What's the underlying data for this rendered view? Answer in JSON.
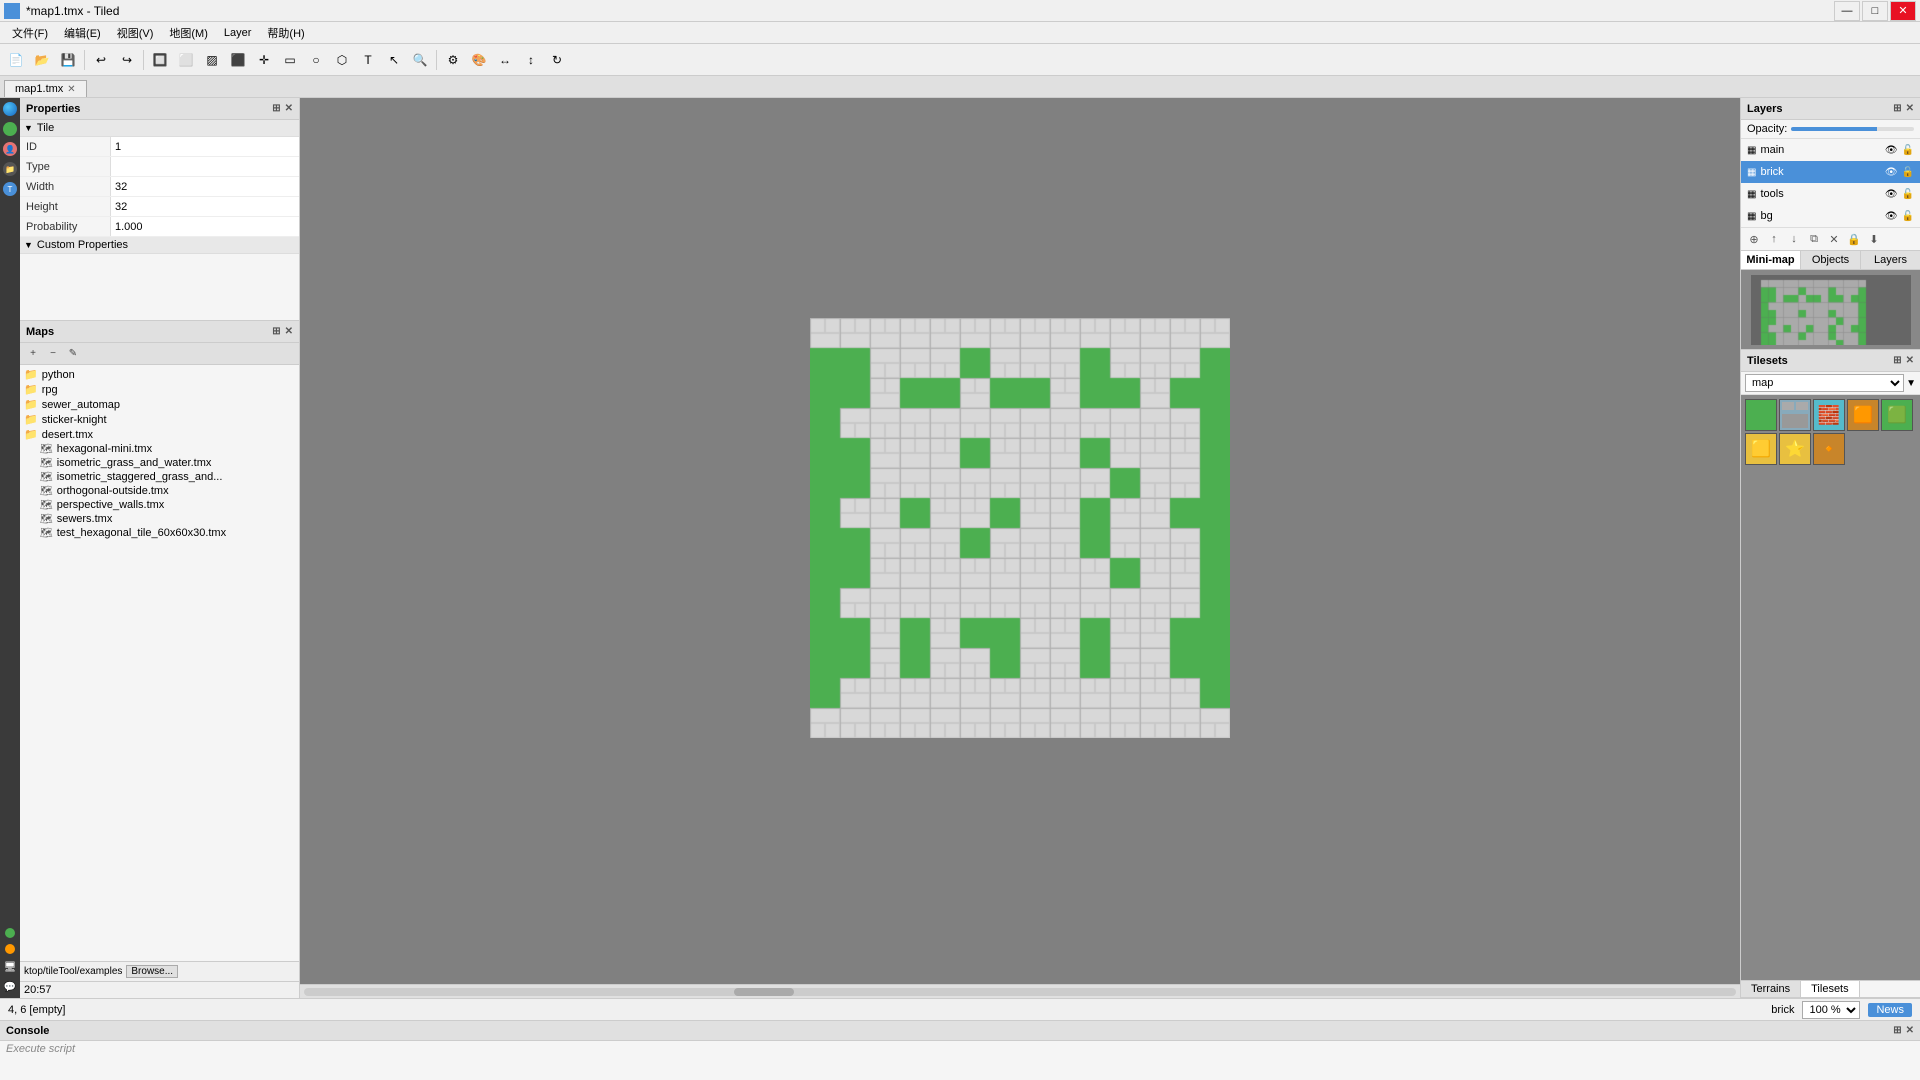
{
  "titleBar": {
    "title": "*map1.tmx - Tiled",
    "appName": "Tiled",
    "minBtn": "—",
    "maxBtn": "□",
    "closeBtn": "✕"
  },
  "menuBar": {
    "items": [
      "文件(F)",
      "编辑(E)",
      "视图(V)",
      "地图(M)",
      "Layer",
      "帮助(H)"
    ]
  },
  "tabs": [
    {
      "label": "map1.tmx",
      "active": true
    }
  ],
  "properties": {
    "title": "Properties",
    "section": "Tile",
    "fields": [
      {
        "label": "ID",
        "value": "1"
      },
      {
        "label": "Type",
        "value": ""
      },
      {
        "label": "Width",
        "value": "32"
      },
      {
        "label": "Height",
        "value": "32"
      },
      {
        "label": "Probability",
        "value": "1.000"
      }
    ],
    "customSection": "Custom Properties"
  },
  "maps": {
    "title": "Maps",
    "folders": [
      {
        "name": "python",
        "type": "folder"
      },
      {
        "name": "rpg",
        "type": "folder"
      },
      {
        "name": "sewer_automap",
        "type": "folder"
      },
      {
        "name": "sticker-knight",
        "type": "folder"
      },
      {
        "name": "desert.tmx",
        "type": "file"
      }
    ],
    "files": [
      {
        "name": "hexagonal-mini.tmx",
        "type": "file"
      },
      {
        "name": "isometric_grass_and_water.tmx",
        "type": "file"
      },
      {
        "name": "isometric_staggered_grass_and...",
        "type": "file"
      },
      {
        "name": "orthogonal-outside.tmx",
        "type": "file"
      },
      {
        "name": "perspective_walls.tmx",
        "type": "file"
      },
      {
        "name": "sewers.tmx",
        "type": "file"
      },
      {
        "name": "test_hexagonal_tile_60x60x30.tmx",
        "type": "file"
      }
    ]
  },
  "layers": {
    "title": "Layers",
    "opacityLabel": "Opacity:",
    "opacityValue": "",
    "items": [
      {
        "name": "main",
        "active": false,
        "visible": true,
        "locked": false
      },
      {
        "name": "brick",
        "active": true,
        "visible": true,
        "locked": false
      },
      {
        "name": "tools",
        "active": false,
        "visible": true,
        "locked": false
      },
      {
        "name": "bg",
        "active": false,
        "visible": true,
        "locked": false
      }
    ]
  },
  "viewTabs": [
    "Mini-map",
    "Objects",
    "Layers"
  ],
  "tilesets": {
    "title": "Tilesets",
    "selectValue": "map",
    "tiles": [
      {
        "color": "#4caf50",
        "selected": false
      },
      {
        "color": "#4a7fa5",
        "selected": false
      },
      {
        "color": "#6ab0de",
        "selected": false
      },
      {
        "color": "#c8852a",
        "selected": false
      },
      {
        "color": "#4caf50",
        "selected": false
      },
      {
        "color": "#e8c040",
        "selected": false
      },
      {
        "color": "#e8c040",
        "selected": false
      },
      {
        "color": "#c8852a",
        "selected": false
      }
    ]
  },
  "bottomTabs": [
    "Terrains",
    "Tilesets"
  ],
  "statusBar": {
    "coords": "4, 6 [empty]",
    "mapName": "brick",
    "zoom": "100 %",
    "newsBtn": "News"
  },
  "console": {
    "title": "Console",
    "content": "Execute script"
  },
  "bottomLeft": {
    "path": "ktop/tileTool/examples",
    "browseBtn": "Browse...",
    "time": "20:57"
  }
}
